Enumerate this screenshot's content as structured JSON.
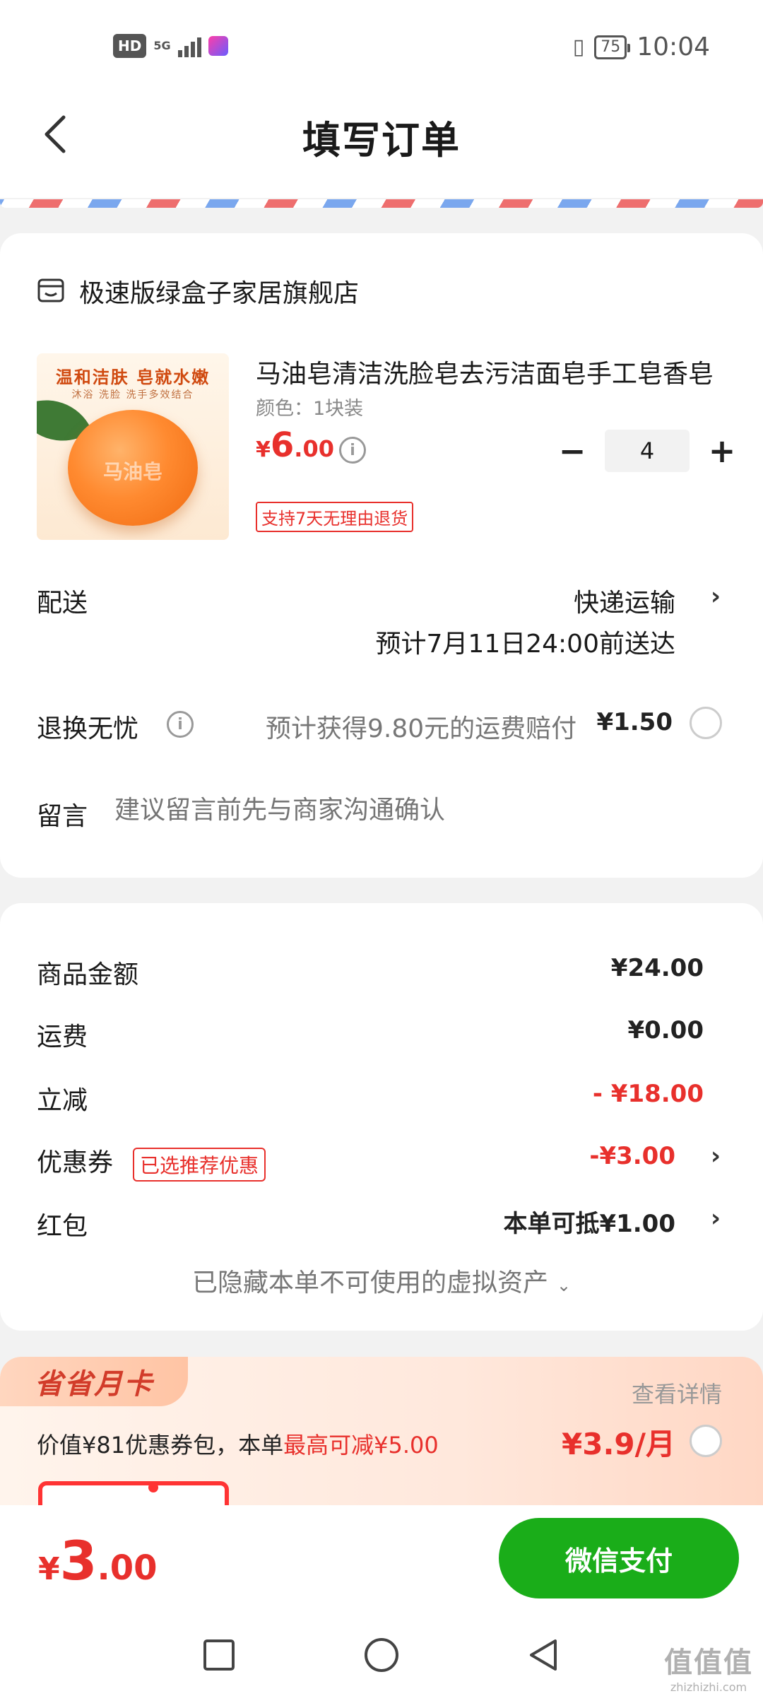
{
  "status_bar": {
    "hd": "HD",
    "network": "5G",
    "battery": "75",
    "time": "10:04"
  },
  "header": {
    "title": "填写订单",
    "back_icon": "chevron-left-icon"
  },
  "order": {
    "shop_name": "极速版绿盒子家居旗舰店",
    "product": {
      "image_title": "温和洁肤 皂就水嫩",
      "image_subtitle": "沐浴 洗脸 洗手多效结合",
      "image_soap_text": "马油皂",
      "name": "马油皂清洁洗脸皂去污洁面皂手工皂香皂",
      "spec": "颜色：1块装",
      "price_currency": "¥",
      "price_int": "6",
      "price_dec": ".00",
      "quantity": "4",
      "return_tag": "支持7天无理由退货"
    },
    "delivery": {
      "label": "配送",
      "method": "快递运输",
      "eta": "预计7月11日24:00前送达"
    },
    "worry_free": {
      "label": "退换无忧",
      "text": "预计获得9.80元的运费赔付",
      "price": "¥1.50"
    },
    "message": {
      "label": "留言",
      "placeholder": "建议留言前先与商家沟通确认"
    }
  },
  "summary": {
    "goods_label": "商品金额",
    "goods_value": "¥24.00",
    "shipping_label": "运费",
    "shipping_value": "¥0.00",
    "discount_label": "立减",
    "discount_value": "- ¥18.00",
    "coupon_label": "优惠券",
    "coupon_tag": "已选推荐优惠",
    "coupon_value": "-¥3.00",
    "redpacket_label": "红包",
    "redpacket_value": "本单可抵¥1.00",
    "hidden_assets": "已隐藏本单不可使用的虚拟资产"
  },
  "month_card": {
    "badge": "省省月卡",
    "detail_link": "查看详情",
    "desc_prefix": "价值¥81优惠券包，本单",
    "desc_highlight": "最高可减¥5.00",
    "price": "¥3.9/月"
  },
  "footer": {
    "total_currency": "¥",
    "total_int": "3",
    "total_dec": ".00",
    "pay_button": "微信支付"
  },
  "watermark": {
    "logo": "值值值",
    "url": "zhizhizhi.com"
  },
  "colors": {
    "accent_red": "#e8302c",
    "wechat_green": "#1aad19"
  }
}
